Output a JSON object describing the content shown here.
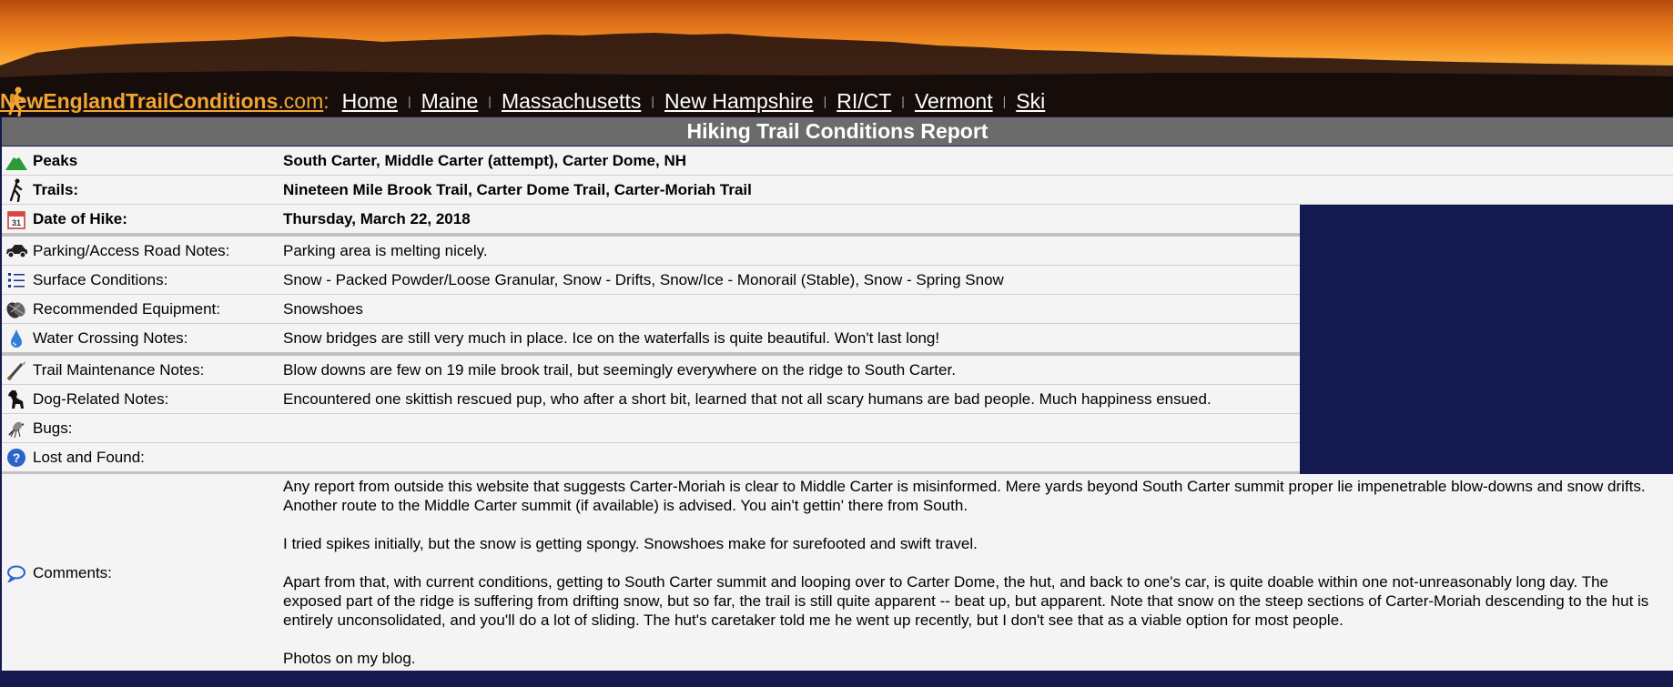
{
  "nav": {
    "site_name": "NewEnglandTrailConditions",
    "site_tld": ".com",
    "colon": ":",
    "links": [
      "Home",
      "Maine",
      "Massachusetts",
      "New Hampshire",
      "RI/CT",
      "Vermont",
      "Ski"
    ]
  },
  "report": {
    "title": "Hiking Trail Conditions Report",
    "rows": [
      {
        "label": "Peaks",
        "value": "South Carter, Middle Carter (attempt), Carter Dome, NH",
        "icon": "mountain-icon"
      },
      {
        "label": "Trails:",
        "value": "Nineteen Mile Brook Trail, Carter Dome Trail, Carter-Moriah Trail",
        "icon": "hiker-icon"
      },
      {
        "label": "Date of Hike:",
        "value": "Thursday, March 22, 2018",
        "icon": "calendar-icon"
      },
      {
        "label": "Parking/Access Road Notes:",
        "value": "Parking area is melting nicely.",
        "icon": "car-icon"
      },
      {
        "label": "Surface Conditions:",
        "value": "Snow - Packed Powder/Loose Granular, Snow - Drifts, Snow/Ice - Monorail (Stable), Snow - Spring Snow",
        "icon": "list-icon"
      },
      {
        "label": "Recommended Equipment:",
        "value": "Snowshoes",
        "icon": "snowshoe-icon"
      },
      {
        "label": "Water Crossing Notes:",
        "value": "Snow bridges are still very much in place. Ice on the waterfalls is quite beautiful. Won't last long!",
        "icon": "water-drop-icon"
      },
      {
        "label": "Trail Maintenance Notes:",
        "value": "Blow downs are few on 19 mile brook trail, but seemingly everywhere on the ridge to South Carter.",
        "icon": "saw-icon"
      },
      {
        "label": "Dog-Related Notes:",
        "value": "Encountered one skittish rescued pup, who after a short bit, learned that not all scary humans are bad people. Much happiness ensued.",
        "icon": "dog-icon"
      },
      {
        "label": "Bugs:",
        "value": "",
        "icon": "mosquito-icon"
      },
      {
        "label": "Lost and Found:",
        "value": "",
        "icon": "question-icon"
      }
    ],
    "comments": {
      "label": "Comments:",
      "icon": "speech-bubble-icon",
      "paragraphs": [
        "Any report from outside this website that suggests Carter-Moriah is clear to Middle Carter is misinformed. Mere yards beyond South Carter summit proper lie impenetrable blow-downs and snow drifts. Another route to the Middle Carter summit (if available) is advised. You ain't gettin' there from South.",
        "I tried spikes initially, but the snow is getting spongy. Snowshoes make for surefooted and swift travel.",
        "Apart from that, with current conditions, getting to South Carter summit and looping over to Carter Dome, the hut, and back to one's car, is quite doable within one not-unreasonably long day. The exposed part of the ridge is suffering from drifting snow, but so far, the trail is still quite apparent -- beat up, but apparent. Note that snow on the steep sections of Carter-Moriah descending to the hut is entirely unconsolidated, and you'll do a lot of sliding. The hut's caretaker told me he went up recently, but I don't see that as a viable option for most people.",
        "Photos on my blog."
      ]
    }
  }
}
